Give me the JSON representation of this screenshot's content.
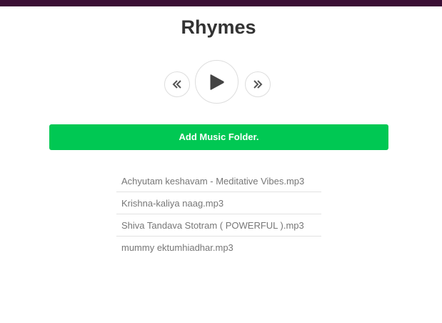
{
  "header": {
    "title": "Rhymes"
  },
  "player": {
    "prev_icon": "double-chevron-left-icon",
    "play_icon": "play-icon",
    "next_icon": "double-chevron-right-icon"
  },
  "actions": {
    "add_folder_label": "Add Music Folder."
  },
  "playlist": {
    "items": [
      {
        "label": "Achyutam keshavam - Meditative Vibes.mp3"
      },
      {
        "label": "Krishna-kaliya naag.mp3"
      },
      {
        "label": "Shiva Tandava Stotram ( POWERFUL ).mp3"
      },
      {
        "label": "mummy ektumhiadhar.mp3"
      }
    ]
  },
  "colors": {
    "topbar": "#3b0f35",
    "accent": "#00c853",
    "text": "#333333",
    "muted": "#777777"
  }
}
